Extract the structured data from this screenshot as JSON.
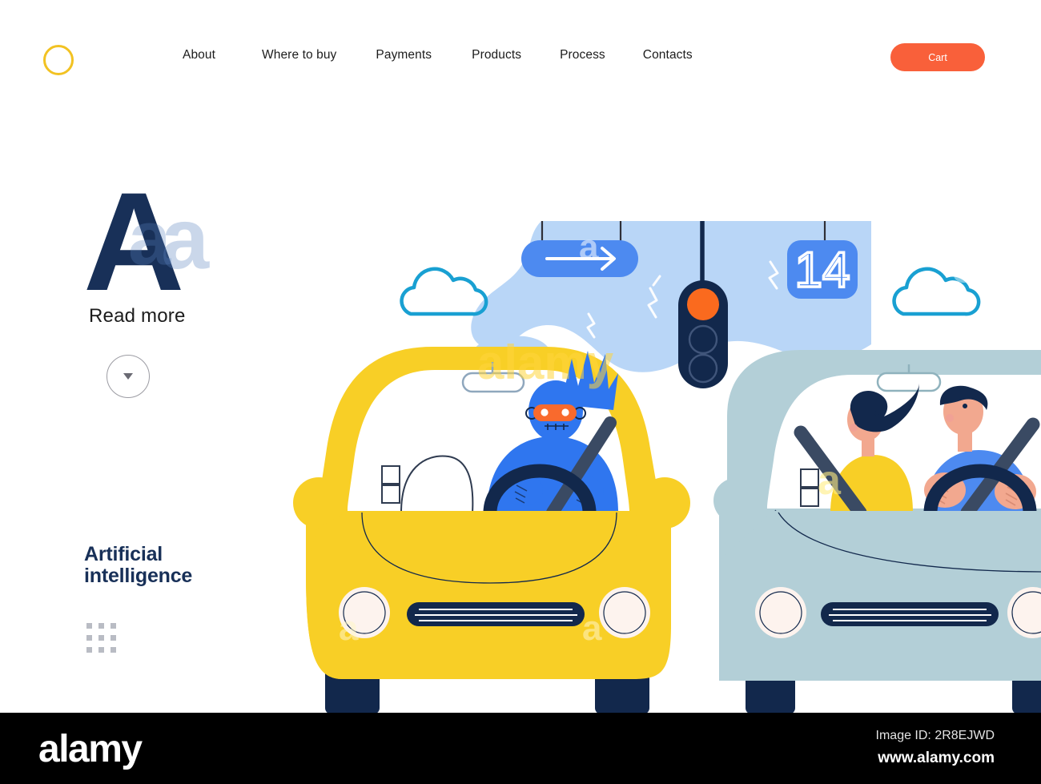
{
  "header": {
    "logo_icon": "circle-ring-logo",
    "logo_color": "#f2c222",
    "nav": [
      {
        "label": "About"
      },
      {
        "label": "Where to buy"
      },
      {
        "label": "Payments"
      },
      {
        "label": "Products"
      },
      {
        "label": "Process"
      },
      {
        "label": "Contacts"
      }
    ],
    "cart_label": "Cart",
    "cart_color": "#f9603a"
  },
  "hero": {
    "big_letter": "A",
    "read_more_label": "Read more",
    "scroll_icon": "chevron-down-icon",
    "headline_line1": "Artificial",
    "headline_line2": "intelligence",
    "headline_color": "#183058",
    "dots_icon": "dot-grid-icon"
  },
  "illustration": {
    "name": "self-driving-cars-at-traffic-light",
    "sky_color": "#b9d6f7",
    "sign_arrow": {
      "icon": "arrow-right-sign",
      "color": "#4d8af0"
    },
    "countdown_sign": {
      "value": "14",
      "color": "#4d8af0"
    },
    "traffic_light": {
      "body_color": "#12284c",
      "active_light": "red",
      "active_color": "#fa6a1e"
    },
    "clouds": [
      {
        "name": "cloud-left",
        "color": "#19a0d2"
      },
      {
        "name": "cloud-right",
        "color": "#19a0d2"
      }
    ],
    "yellow_car": {
      "body_color": "#f9cf25",
      "driver": "robot-driver",
      "robot_color": "#3781f0",
      "visor_color": "#f96a2d"
    },
    "blue_car": {
      "body_color": "#b3cfd7",
      "passengers": [
        "woman-yellow-top",
        "man-blue-shirt"
      ]
    },
    "grille_color": "#12284c",
    "tire_color": "#12284c",
    "headlight_color": "#fdf3ee"
  },
  "footer": {
    "brand": "alamy",
    "image_id": "Image ID: 2R8EJWD",
    "url": "www.alamy.com"
  },
  "watermarks": {
    "alamy_small": "a",
    "alamy_word": "alamy"
  }
}
